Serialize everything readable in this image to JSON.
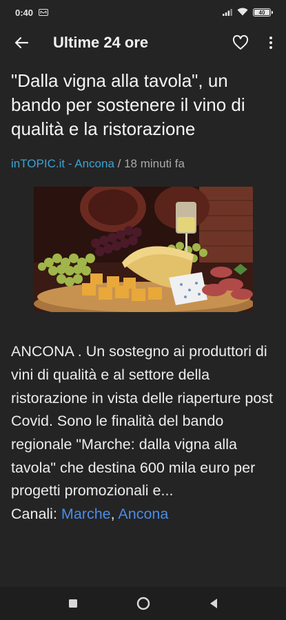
{
  "status": {
    "time": "0:40",
    "battery": "40"
  },
  "app_bar": {
    "title": "Ultime 24 ore"
  },
  "article": {
    "headline": "\"Dalla vigna alla tavola\", un bando per sostenere il vino di qualità e la ristorazione",
    "source": "inTOPIC.it - Ancona",
    "separator": " / ",
    "time_ago": "18 minuti fa",
    "body": "ANCONA . Un sostegno ai produttori di vini di qualità e al settore della ristorazione in vista delle riaperture post Covid. Sono le finalità del bando regionale \"Marche: dalla vigna alla tavola\" che destina 600 mila euro per progetti promozionali e...",
    "channels_label": "Canali:",
    "channels": [
      "Marche",
      "Ancona"
    ]
  },
  "colors": {
    "background": "#242424",
    "link": "#4a8de8",
    "source": "#3aa3d4"
  }
}
